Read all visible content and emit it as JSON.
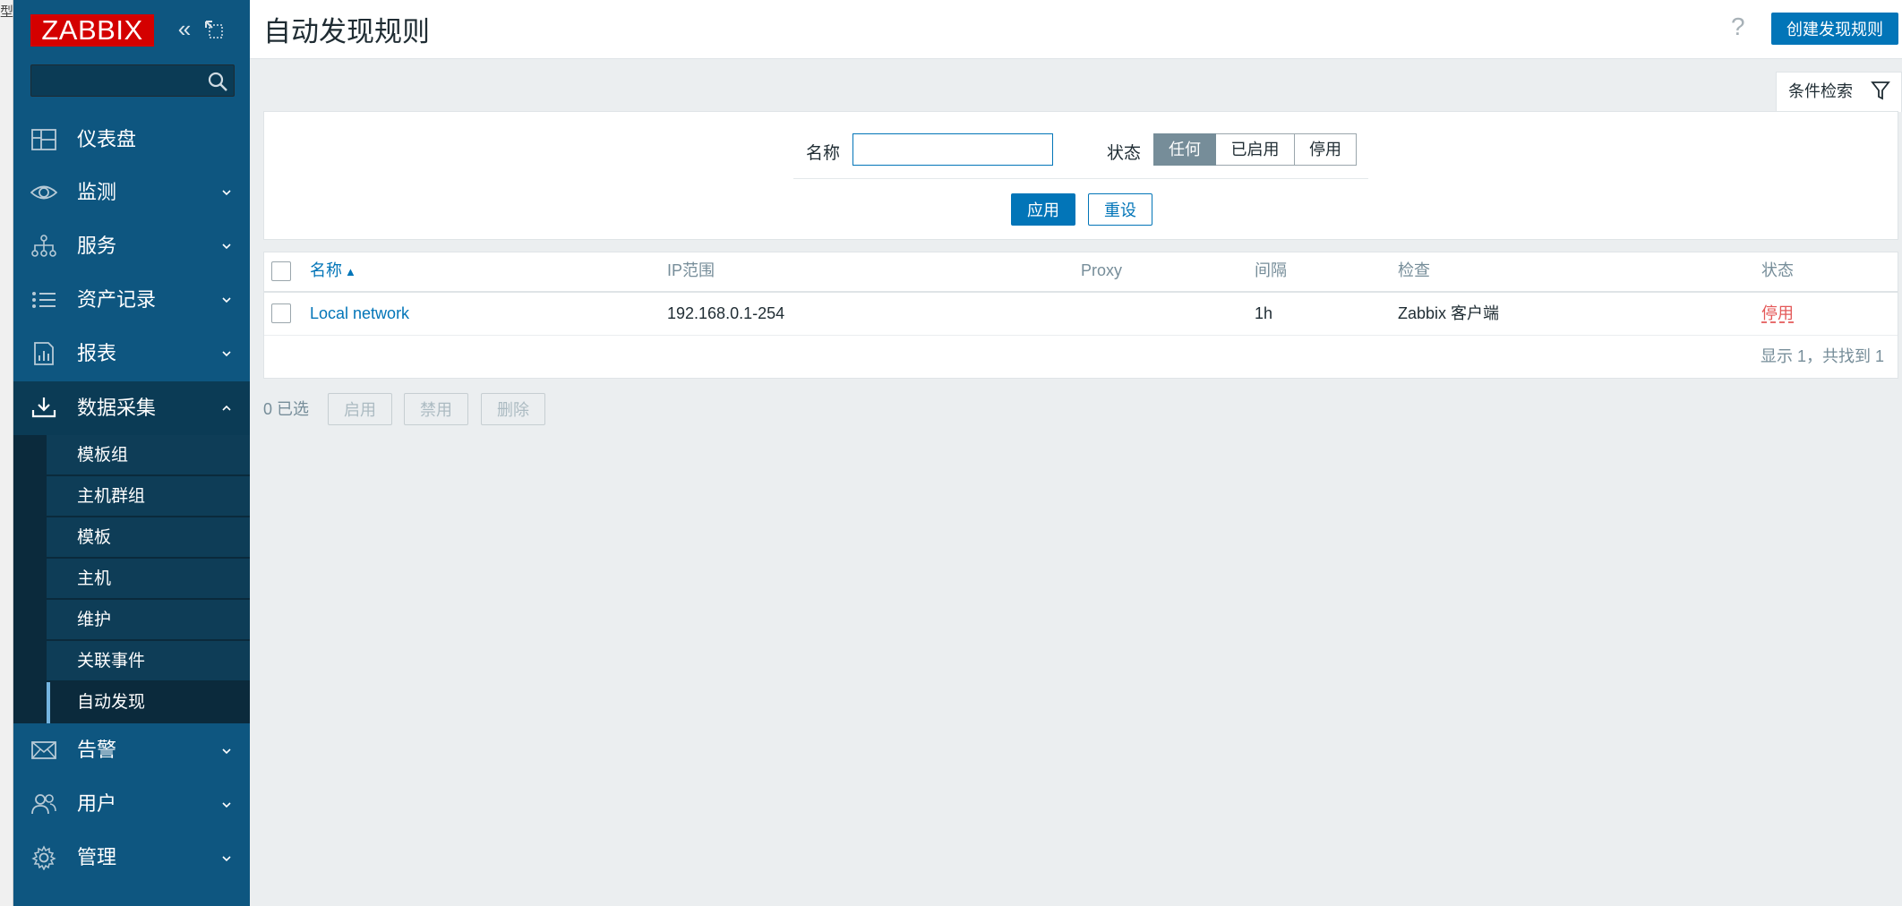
{
  "left_strip_glyph": "型",
  "sidebar": {
    "logo": "ZABBIX",
    "search": {
      "value": "",
      "placeholder": ""
    },
    "items": [
      {
        "label": "仪表盘",
        "icon": "dashboard-icon"
      },
      {
        "label": "监测",
        "icon": "eye-icon"
      },
      {
        "label": "服务",
        "icon": "services-icon"
      },
      {
        "label": "资产记录",
        "icon": "list-icon"
      },
      {
        "label": "报表",
        "icon": "report-icon"
      },
      {
        "label": "数据采集",
        "icon": "download-icon"
      },
      {
        "label": "告警",
        "icon": "mail-icon"
      },
      {
        "label": "用户",
        "icon": "users-icon"
      },
      {
        "label": "管理",
        "icon": "gear-icon"
      }
    ],
    "submenu": [
      "模板组",
      "主机群组",
      "模板",
      "主机",
      "维护",
      "关联事件",
      "自动发现"
    ]
  },
  "header": {
    "title": "自动发现规则",
    "help": "?",
    "create_button": "创建发现规则"
  },
  "filter": {
    "tab_label": "条件检索",
    "name_label": "名称",
    "name_value": "",
    "status_label": "状态",
    "status_options": [
      "任何",
      "已启用",
      "停用"
    ],
    "status_selected": "任何",
    "apply": "应用",
    "reset": "重设"
  },
  "table": {
    "columns": [
      "名称",
      "IP范围",
      "Proxy",
      "间隔",
      "检查",
      "状态"
    ],
    "sort_arrow": "▲",
    "rows": [
      {
        "name": "Local network",
        "ip_range": "192.168.0.1-254",
        "proxy": "",
        "interval": "1h",
        "checks": "Zabbix 客户端",
        "status": "停用"
      }
    ],
    "footer": "显示 1，共找到 1"
  },
  "actions": {
    "selected_count": "0 已选",
    "enable": "启用",
    "disable": "禁用",
    "delete": "删除"
  },
  "colors": {
    "sidebar_bg": "#0e5680",
    "accent": "#0275b8",
    "logo_red": "#d40000",
    "status_disabled": "#e45959"
  }
}
